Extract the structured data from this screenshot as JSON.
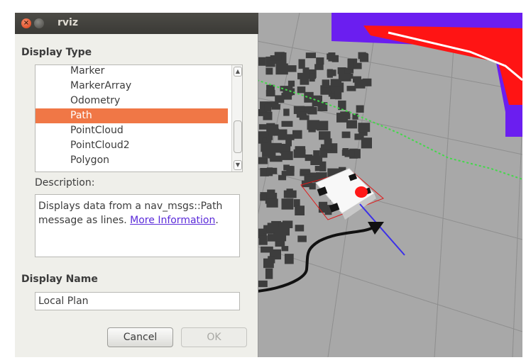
{
  "window": {
    "title": "rviz",
    "close_icon": "close-icon",
    "minimize_icon": "minimize-icon"
  },
  "display_type": {
    "label": "Display Type",
    "items": [
      "Marker",
      "MarkerArray",
      "Odometry",
      "Path",
      "PointCloud",
      "PointCloud2",
      "Polygon"
    ],
    "selected": "Path"
  },
  "description": {
    "label": "Description:",
    "text": "Displays data from a nav_msgs::Path message as lines.",
    "link": "More Information",
    "end": "."
  },
  "display_name": {
    "label": "Display Name",
    "value": "Local Plan"
  },
  "buttons": {
    "cancel": "Cancel",
    "ok": "OK"
  },
  "colors": {
    "selection": "#f07746",
    "link": "#5a2ad9",
    "costmap_purple": "#6b1ef0",
    "costmap_red": "#ff1414",
    "path_green": "#43d84a",
    "heading_blue": "#3b30e8"
  }
}
